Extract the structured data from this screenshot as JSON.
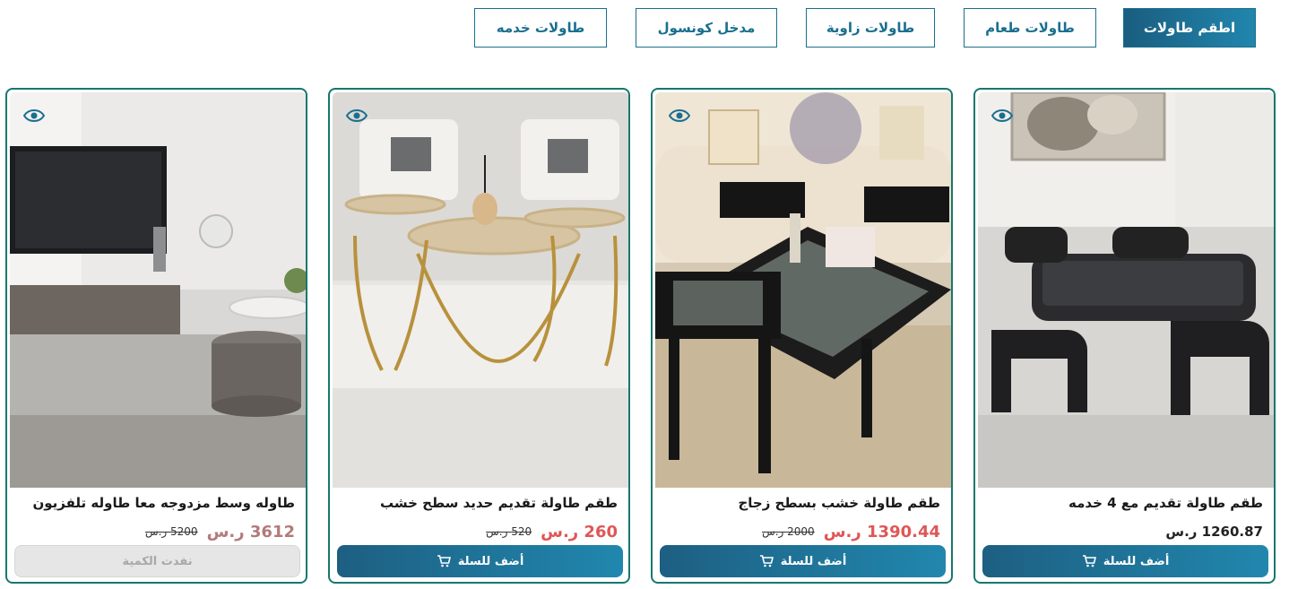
{
  "tabs": [
    {
      "label": "اطقم طاولات",
      "active": true
    },
    {
      "label": "طاولات طعام",
      "active": false
    },
    {
      "label": "طاولات زاوية",
      "active": false
    },
    {
      "label": "مدخل كونسول",
      "active": false
    },
    {
      "label": "طاولات خدمه",
      "active": false
    }
  ],
  "colors": {
    "accent": "#1a6f8e",
    "card_border": "#17776f",
    "sale_price": "#e05656"
  },
  "products": [
    {
      "title": "طقم طاولة تقديم مع 4 خدمه",
      "price": "1260.87 ر.س",
      "button": "أضف للسلة",
      "icon": "eye-icon"
    },
    {
      "title": "طقم طاولة خشب بسطح زجاج",
      "price": "1390.44 ر.س",
      "old_price": "2000 ر.س",
      "button": "أضف للسلة",
      "icon": "eye-icon"
    },
    {
      "title": "طقم طاولة تقديم حديد سطح خشب",
      "price": "260 ر.س",
      "old_price": "520 ر.س",
      "button": "أضف للسلة",
      "icon": "eye-icon"
    },
    {
      "title": "طاوله وسط مزدوجه معا طاوله تلفزيون",
      "price": "3612 ر.س",
      "old_price": "5200 ر.س",
      "button": "نفدت الكمية",
      "icon": "eye-icon"
    }
  ]
}
